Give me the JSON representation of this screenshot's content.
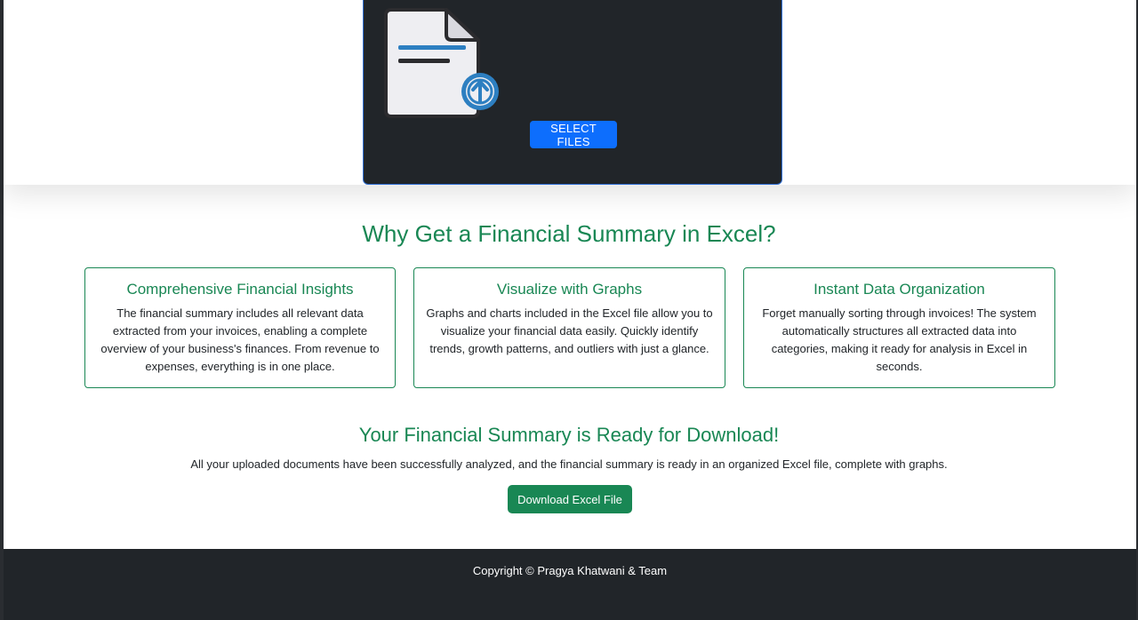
{
  "upload": {
    "select_label": "SELECT FILES",
    "icon": "file-upload-icon",
    "accent": "#0d6efd",
    "card_bg": "#212529"
  },
  "why": {
    "title": "Why Get a Financial Summary in Excel?",
    "cards": [
      {
        "title": "Comprehensive Financial Insights",
        "text": "The financial summary includes all relevant data extracted from your invoices, enabling a complete overview of your business's finances. From revenue to expenses, everything is in one place."
      },
      {
        "title": "Visualize with Graphs",
        "text": "Graphs and charts included in the Excel file allow you to visualize your financial data easily. Quickly identify trends, growth patterns, and outliers with just a glance."
      },
      {
        "title": "Instant Data Organization",
        "text": "Forget manually sorting through invoices! The system automatically structures all extracted data into categories, making it ready for analysis in Excel in seconds."
      }
    ]
  },
  "ready": {
    "title": "Your Financial Summary is Ready for Download!",
    "text": "All your uploaded documents have been successfully analyzed, and the financial summary is ready in an organized Excel file, complete with graphs.",
    "download_label": "Download Excel File"
  },
  "footer": {
    "text": "Copyright © Pragya Khatwani & Team"
  },
  "colors": {
    "primary": "#0d6efd",
    "success": "#198754",
    "dark": "#212529"
  }
}
